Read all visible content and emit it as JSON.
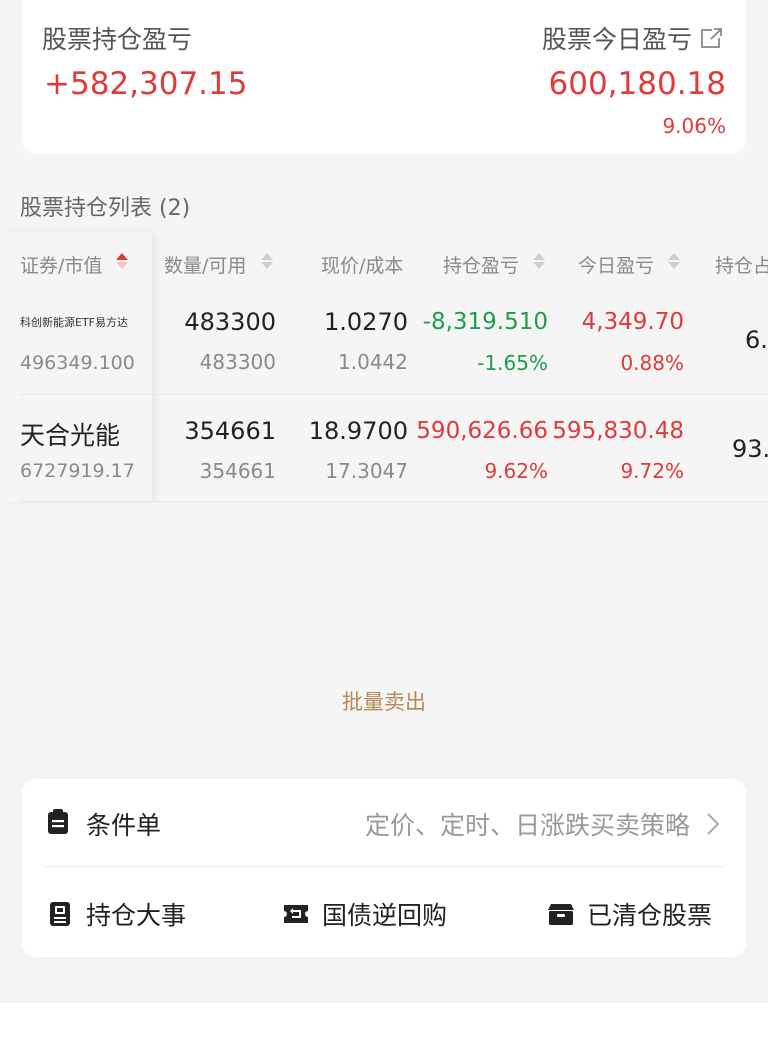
{
  "summary": {
    "holding_label": "股票持仓盈亏",
    "holding_value": "+582,307.15",
    "today_label": "股票今日盈亏",
    "today_value": "600,180.18",
    "today_pct": "9.06%"
  },
  "list": {
    "title": "股票持仓列表 (2)",
    "headers": {
      "security": "证券/市值",
      "qty": "数量/可用",
      "price": "现价/成本",
      "pnl": "持仓盈亏",
      "today": "今日盈亏",
      "ratio": "持仓占"
    },
    "rows": [
      {
        "name": "科创新能源ETF易方达",
        "market_value": "496349.100",
        "qty": "483300",
        "available": "483300",
        "price": "1.0270",
        "cost": "1.0442",
        "pnl": "-8,319.510",
        "pnl_pct": "-1.65%",
        "today": "4,349.70",
        "today_pct": "0.88%",
        "ratio": "6."
      },
      {
        "name": "天合光能",
        "market_value": "6727919.17",
        "qty": "354661",
        "available": "354661",
        "price": "18.9700",
        "cost": "17.3047",
        "pnl": "590,626.66",
        "pnl_pct": "9.62%",
        "today": "595,830.48",
        "today_pct": "9.72%",
        "ratio": "93."
      }
    ]
  },
  "batch_sell": "批量卖出",
  "menu": {
    "conditional": "条件单",
    "conditional_hint": "定价、定时、日涨跌买卖策略",
    "events": "持仓大事",
    "repo": "国债逆回购",
    "cleared": "已清仓股票"
  },
  "colors": {
    "red": "#e03a3a",
    "green": "#1f9e4a",
    "gold": "#b38a55"
  }
}
